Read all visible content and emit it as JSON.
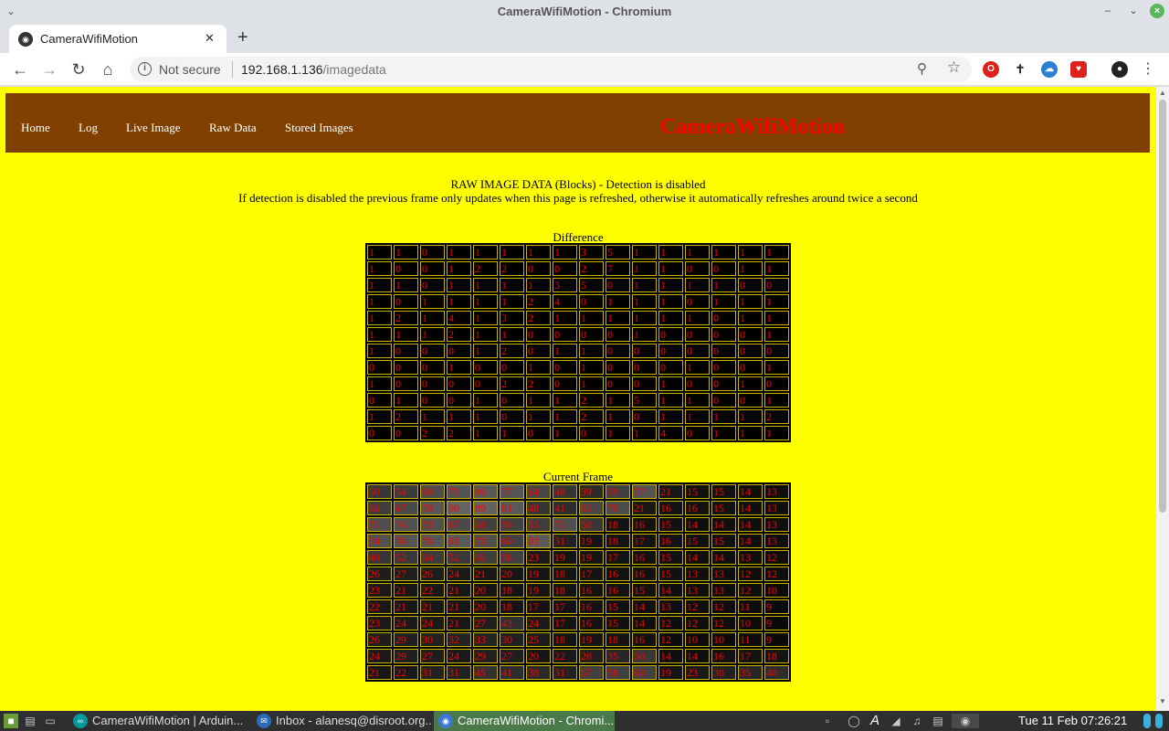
{
  "window": {
    "title": "CameraWifiMotion - Chromium"
  },
  "tab": {
    "title": "CameraWifiMotion"
  },
  "omnibox": {
    "security": "Not secure",
    "host": "192.168.1.136",
    "path": "/imagedata"
  },
  "nav": {
    "links": [
      "Home",
      "Log",
      "Live Image",
      "Raw Data",
      "Stored Images"
    ],
    "brand": "CameraWifiMotion"
  },
  "info": {
    "line1": "RAW IMAGE DATA (Blocks) - Detection is disabled",
    "line2": "If detection is disabled the previous frame only updates when this page is refreshed, otherwise it automatically refreshes around twice a second"
  },
  "difference": {
    "caption": "Difference",
    "rows": [
      [
        1,
        1,
        0,
        1,
        1,
        1,
        1,
        1,
        3,
        5,
        1,
        1,
        1,
        1,
        1,
        1
      ],
      [
        1,
        0,
        0,
        1,
        2,
        2,
        0,
        0,
        2,
        7,
        1,
        1,
        0,
        0,
        1,
        1
      ],
      [
        1,
        1,
        0,
        1,
        1,
        1,
        1,
        3,
        5,
        0,
        1,
        1,
        1,
        1,
        0,
        0
      ],
      [
        1,
        0,
        1,
        1,
        1,
        1,
        2,
        4,
        0,
        1,
        1,
        1,
        0,
        1,
        1,
        1
      ],
      [
        1,
        2,
        1,
        4,
        1,
        3,
        2,
        1,
        1,
        1,
        1,
        1,
        1,
        0,
        1,
        1
      ],
      [
        1,
        1,
        1,
        2,
        1,
        1,
        0,
        0,
        0,
        0,
        1,
        0,
        0,
        0,
        0,
        1
      ],
      [
        1,
        0,
        0,
        0,
        1,
        2,
        0,
        1,
        1,
        0,
        0,
        0,
        0,
        0,
        0,
        0
      ],
      [
        0,
        0,
        0,
        1,
        0,
        0,
        1,
        0,
        1,
        0,
        0,
        0,
        1,
        0,
        0,
        1
      ],
      [
        1,
        0,
        0,
        0,
        0,
        2,
        2,
        0,
        1,
        0,
        0,
        1,
        0,
        0,
        1,
        0
      ],
      [
        0,
        1,
        0,
        0,
        1,
        0,
        1,
        1,
        2,
        1,
        5,
        1,
        1,
        0,
        0,
        1
      ],
      [
        1,
        2,
        1,
        1,
        1,
        0,
        1,
        1,
        2,
        1,
        0,
        1,
        1,
        1,
        1,
        2
      ],
      [
        0,
        0,
        2,
        2,
        1,
        1,
        0,
        1,
        0,
        1,
        1,
        4,
        0,
        1,
        1,
        1
      ]
    ]
  },
  "current": {
    "caption": "Current Frame",
    "rows": [
      [
        50,
        54,
        69,
        75,
        80,
        77,
        64,
        48,
        39,
        59,
        77,
        21,
        15,
        15,
        14,
        13
      ],
      [
        56,
        67,
        78,
        90,
        89,
        81,
        48,
        41,
        65,
        70,
        21,
        16,
        16,
        15,
        14,
        13
      ],
      [
        71,
        74,
        73,
        67,
        58,
        59,
        55,
        73,
        50,
        18,
        16,
        15,
        14,
        14,
        14,
        13
      ],
      [
        74,
        76,
        79,
        81,
        73,
        60,
        83,
        31,
        19,
        18,
        17,
        16,
        15,
        15,
        14,
        13
      ],
      [
        49,
        52,
        54,
        52,
        56,
        58,
        23,
        19,
        19,
        17,
        16,
        15,
        14,
        14,
        13,
        12
      ],
      [
        26,
        27,
        26,
        24,
        21,
        20,
        19,
        18,
        17,
        16,
        16,
        15,
        13,
        13,
        12,
        12
      ],
      [
        23,
        21,
        22,
        21,
        20,
        18,
        19,
        18,
        16,
        16,
        15,
        14,
        13,
        13,
        12,
        10
      ],
      [
        22,
        21,
        21,
        21,
        20,
        18,
        17,
        17,
        16,
        15,
        14,
        13,
        12,
        12,
        11,
        9
      ],
      [
        23,
        24,
        24,
        21,
        27,
        43,
        24,
        17,
        16,
        15,
        14,
        12,
        12,
        12,
        10,
        9
      ],
      [
        26,
        29,
        30,
        32,
        33,
        30,
        25,
        18,
        19,
        18,
        16,
        12,
        10,
        10,
        11,
        9
      ],
      [
        24,
        29,
        27,
        24,
        29,
        27,
        20,
        22,
        28,
        35,
        50,
        14,
        14,
        16,
        17,
        18
      ],
      [
        21,
        22,
        31,
        31,
        45,
        41,
        38,
        31,
        57,
        58,
        60,
        19,
        23,
        30,
        35,
        40
      ]
    ]
  },
  "taskbar": {
    "tasks": [
      "CameraWifiMotion | Arduin...",
      "Inbox - alanesq@disroot.org...",
      "CameraWifiMotion - Chromi..."
    ],
    "clock": "Tue 11 Feb 07:26:21"
  }
}
